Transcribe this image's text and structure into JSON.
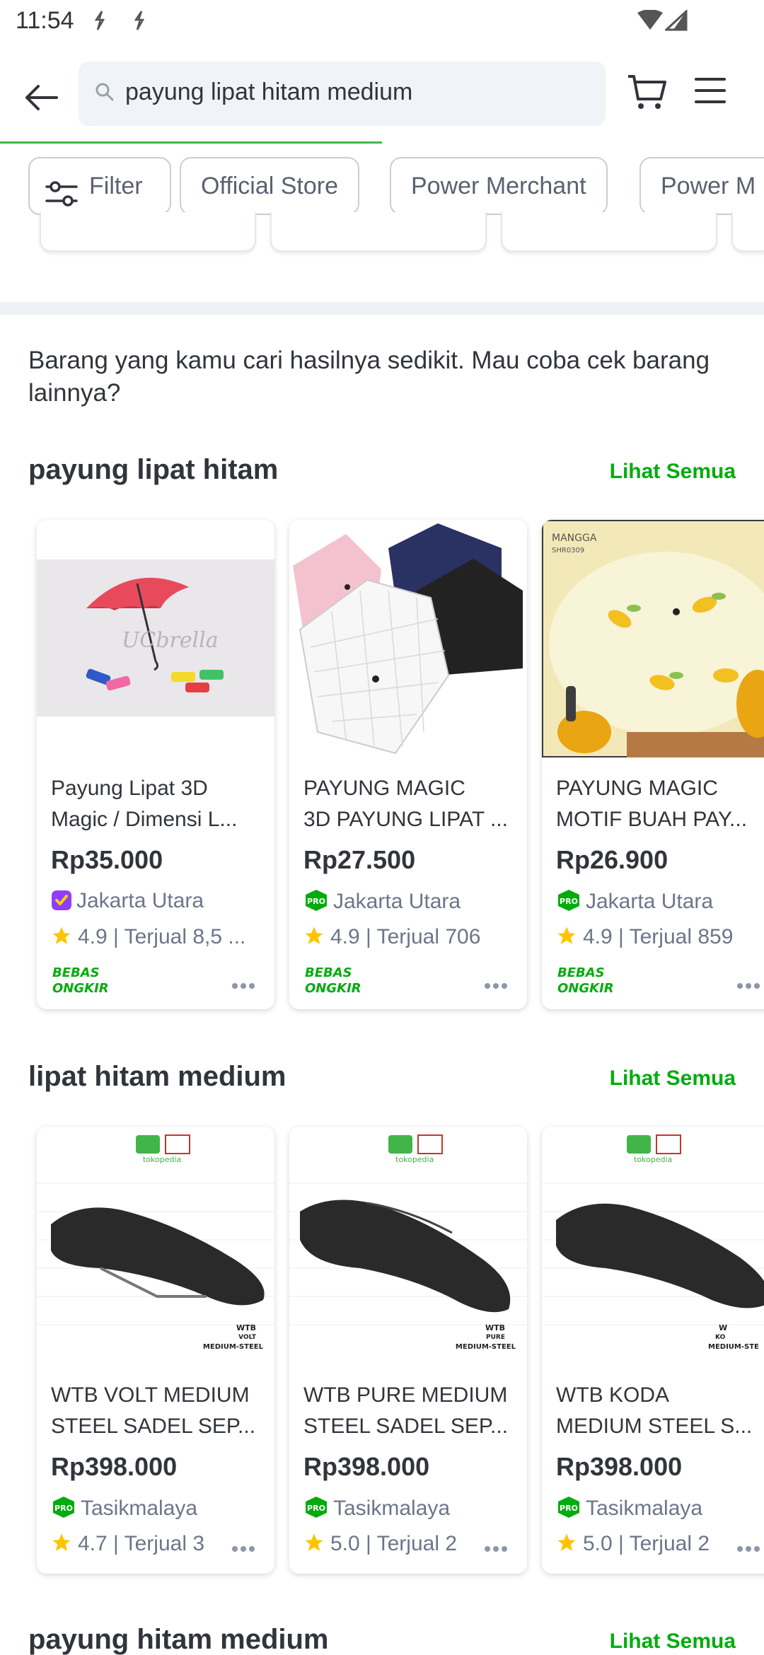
{
  "status_bar": {
    "time": "11:54"
  },
  "search": {
    "query": "payung lipat hitam medium"
  },
  "chips": [
    {
      "label": "Filter"
    },
    {
      "label": "Official Store"
    },
    {
      "label": "Power Merchant"
    },
    {
      "label": "Power M"
    }
  ],
  "notice": "Barang yang kamu cari hasilnya sedikit. Mau coba cek barang lainnya?",
  "sections": [
    {
      "title": "payung lipat hitam",
      "see_all": "Lihat Semua",
      "products": [
        {
          "name_line1": "Payung Lipat 3D",
          "name_line2": "Magic / Dimensi L...",
          "price": "Rp35.000",
          "location": "Jakarta Utara",
          "shop_badge": "official-store-badge",
          "rating": "4.9 | Terjual 8,5 ...",
          "free_shipping": true
        },
        {
          "name_line1": "PAYUNG MAGIC",
          "name_line2": "3D PAYUNG LIPAT ...",
          "price": "Rp27.500",
          "location": "Jakarta Utara",
          "shop_badge": "pro-badge",
          "rating": "4.9 | Terjual 706",
          "free_shipping": true
        },
        {
          "name_line1": "PAYUNG MAGIC",
          "name_line2": "MOTIF BUAH PAY...",
          "price": "Rp26.900",
          "location": "Jakarta Utara",
          "shop_badge": "pro-badge",
          "rating": "4.9 | Terjual 859",
          "free_shipping": true
        }
      ]
    },
    {
      "title": "lipat hitam medium",
      "see_all": "Lihat Semua",
      "products": [
        {
          "name_line1": "WTB VOLT MEDIUM",
          "name_line2": "STEEL SADEL SEP...",
          "price": "Rp398.000",
          "location": "Tasikmalaya",
          "shop_badge": "pro-badge",
          "rating": "4.7 | Terjual 3",
          "free_shipping": false
        },
        {
          "name_line1": "WTB PURE MEDIUM",
          "name_line2": "STEEL SADEL SEP...",
          "price": "Rp398.000",
          "location": "Tasikmalaya",
          "shop_badge": "pro-badge",
          "rating": "5.0 | Terjual 2",
          "free_shipping": false
        },
        {
          "name_line1": "WTB KODA",
          "name_line2": "MEDIUM STEEL S...",
          "price": "Rp398.000",
          "location": "Tasikmalaya",
          "shop_badge": "pro-badge",
          "rating": "5.0 | Terjual 2",
          "free_shipping": false
        }
      ]
    },
    {
      "title": "payung hitam medium",
      "see_all": "Lihat Semua"
    }
  ],
  "ongkir_badge": {
    "line1": "BEBAS",
    "line2": "ONGKIR"
  },
  "colors": {
    "accent_green": "#03ac0e",
    "text": "#31353b",
    "muted": "#6d7588",
    "star": "#ffc400",
    "os_purple": "#8f3dff"
  },
  "image_labels": {
    "umbrella_watermark": "UCbrella",
    "mango_tag_line1": "MANGGA",
    "mango_tag_line2": "SHR0309",
    "store_logo": "tokopedia",
    "saddle_1_line1": "WTB",
    "saddle_1_line2": "VOLT",
    "saddle_1_line3": "MEDIUM-STEEL",
    "saddle_2_line1": "WTB",
    "saddle_2_line2": "PURE",
    "saddle_2_line3": "MEDIUM-STEEL",
    "saddle_3_line1": "W",
    "saddle_3_line2": "KO",
    "saddle_3_line3": "MEDIUM-STE"
  }
}
